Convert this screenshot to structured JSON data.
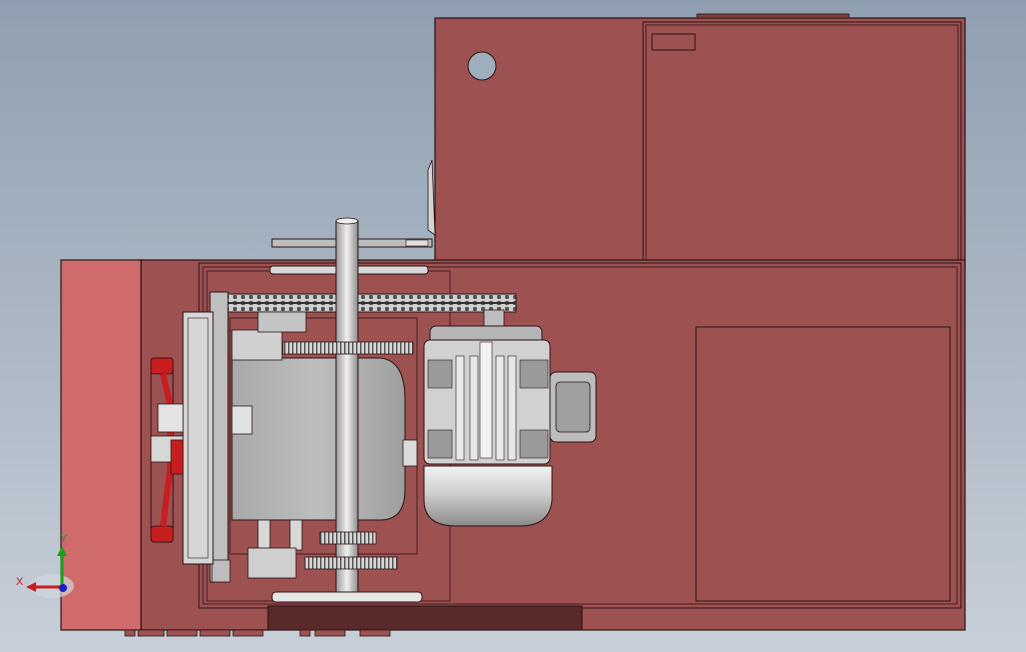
{
  "viewport": {
    "background_top": "#8f9fb1",
    "background_bottom": "#c7cfd8"
  },
  "model": {
    "frame_color": "#9e5151",
    "frame_light_color": "#cf6b6b",
    "edge_color": "#2a1414",
    "motor_color": "#c9c9c9",
    "handwheel_color": "#c81e1e"
  },
  "triad": {
    "x_label": "X",
    "y_label": "Y",
    "x_color": "#c81e1e",
    "y_color": "#18a018",
    "z_color": "#1e1ec8"
  }
}
